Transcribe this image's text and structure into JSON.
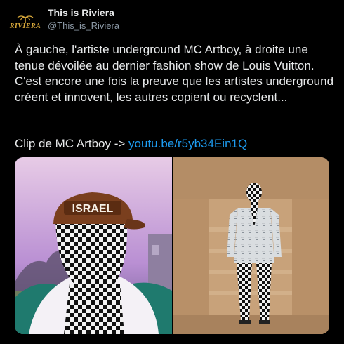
{
  "account": {
    "display_name": "This is Riviera",
    "handle": "@This_is_Riviera",
    "avatar_text": "RIVIERA"
  },
  "tweet": {
    "text": "À gauche, l'artiste underground MC Artboy, à droite une tenue dévoilée au dernier fashion show de Louis Vuitton. C'est encore une fois la preuve que les artistes underground créent et innovent, les autres copient ou recyclent...",
    "clip_prefix": "Clip de MC Artboy -> ",
    "clip_link": "youtu.be/r5yb34Ein1Q"
  },
  "media": {
    "left_image": {
      "icon": "person-in-checkered-mask-photo",
      "cap_text": "ISRAEL"
    },
    "right_image": {
      "icon": "checkered-suit-runway-photo"
    }
  }
}
